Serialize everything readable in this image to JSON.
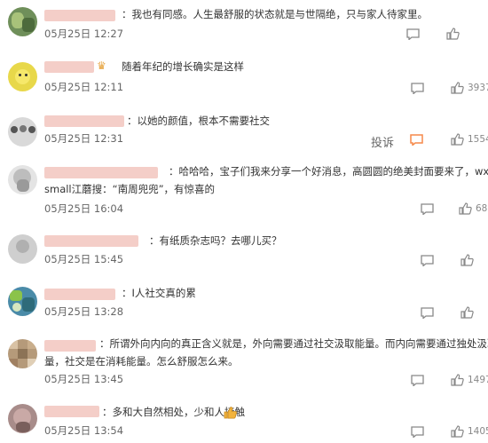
{
  "comments": [
    {
      "text": "：我也有同感。人生最舒服的状态就是与世隔绝，只与家人待家里。",
      "time": "05月25日 12:27",
      "likes": ""
    },
    {
      "text": "随着年纪的增长确实是这样",
      "time": "05月25日 12:11",
      "likes": "3937"
    },
    {
      "text": "：以她的颜值，根本不需要社交",
      "time": "05月25日 12:31",
      "likes": "1554",
      "report": "投诉"
    },
    {
      "text": "：哈哈哈，宝子们我来分享一个好消息，高圆圆的绝美封面要来了，wx或",
      "text2": "small江蘑搜：“南周兜兜”，有惊喜的",
      "time": "05月25日 16:04",
      "likes": "68"
    },
    {
      "text": "：有纸质杂志吗？去哪儿买？",
      "time": "05月25日 15:45",
      "likes": ""
    },
    {
      "text": "：I人社交真的累",
      "time": "05月25日 13:28",
      "likes": ""
    },
    {
      "text": "：所谓外向内向的真正含义就是，外向需要通过社交汲取能量。而内向需要通过独处汲取能",
      "text2": "量，社交是在消耗能量。怎么舒服怎么来。",
      "time": "05月25日 13:45",
      "likes": "1497"
    },
    {
      "text": "：多和大自然相处，少和人接触",
      "time": "05月25日 13:54",
      "likes": "1405"
    }
  ],
  "icons": {
    "reply": "comment-icon",
    "like": "thumbs-up-icon",
    "report": "report-flag-icon",
    "crown": "crown-badge-icon",
    "thumb_emoji": "thumbs-up-emoji"
  },
  "colors": {
    "blurred_name": "#f3c9c2",
    "report_icon": "#f5894a",
    "text": "#333333",
    "meta": "#666666"
  }
}
